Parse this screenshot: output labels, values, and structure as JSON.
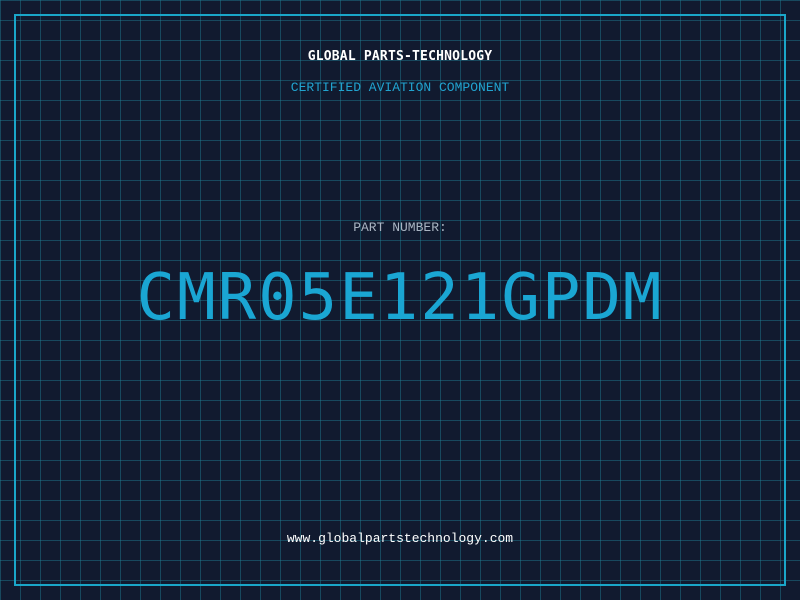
{
  "header": {
    "brand": "GLOBAL PARTS-TECHNOLOGY",
    "tagline": "CERTIFIED AVIATION COMPONENT"
  },
  "part": {
    "label": "PART NUMBER:",
    "number": "CMR05E121GPDM"
  },
  "footer": {
    "url": "www.globalpartstechnology.com"
  },
  "colors": {
    "background": "#111a2f",
    "grid": "#208296",
    "accent": "#1aa6d3",
    "frame": "#1aa6c8"
  }
}
